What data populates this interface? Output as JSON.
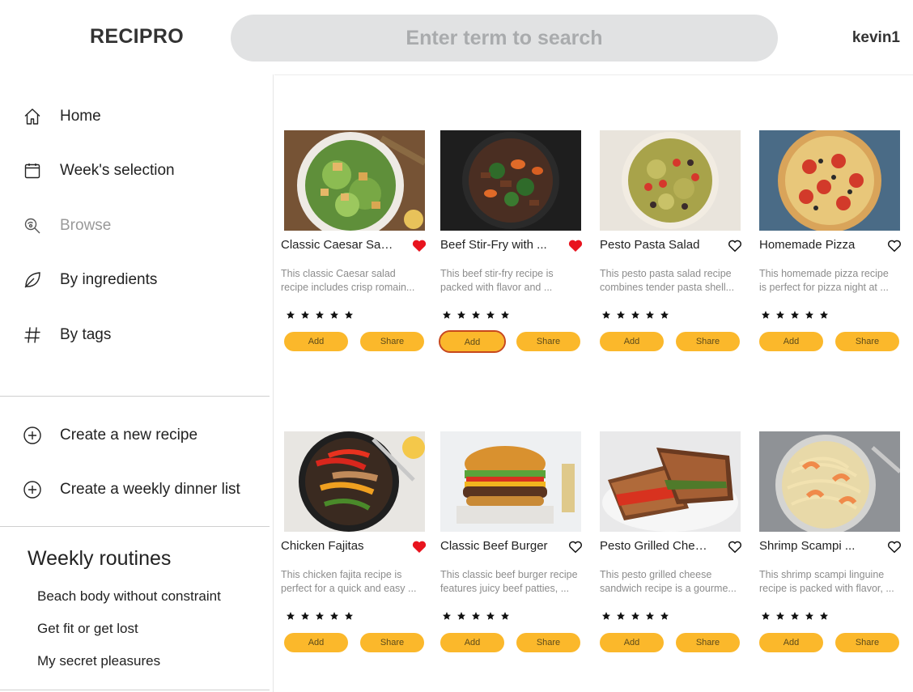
{
  "app": {
    "logo": "RECIPRO",
    "user": "kevin1"
  },
  "search": {
    "placeholder": "Enter term to search"
  },
  "nav": {
    "items": [
      {
        "label": "Home",
        "icon": "home-icon"
      },
      {
        "label": "Week's selection",
        "icon": "calendar-icon"
      },
      {
        "label": "Browse",
        "icon": "browse-icon"
      },
      {
        "label": "By ingredients",
        "icon": "leaf-icon"
      },
      {
        "label": "By tags",
        "icon": "hashtag-icon"
      }
    ],
    "actions": [
      {
        "label": "Create a new recipe",
        "icon": "plus-circle-icon"
      },
      {
        "label": "Create a weekly dinner list",
        "icon": "plus-circle-icon"
      }
    ]
  },
  "routines": {
    "title": "Weekly routines",
    "items": [
      "Beach body without constraint",
      "Get fit or get lost",
      "My secret pleasures"
    ]
  },
  "buttons": {
    "add": "Add",
    "share": "Share"
  },
  "colors": {
    "accent": "#fbb82b",
    "heart_active": "#e8141e",
    "focus_ring": "#c8481b"
  },
  "recipes": [
    {
      "title": "Classic Caesar Salad",
      "desc1": "This classic Caesar salad",
      "desc2": "recipe includes crisp romain...",
      "favorite": true,
      "rating": 5,
      "image": "caesar-salad-photo"
    },
    {
      "title": "Beef Stir-Fry with ...",
      "desc1": "This beef stir-fry recipe is",
      "desc2": "packed with flavor and ...",
      "favorite": true,
      "rating": 5,
      "image": "beef-stir-fry-photo"
    },
    {
      "title": "Pesto Pasta Salad",
      "desc1": "This pesto pasta salad recipe",
      "desc2": "combines tender pasta shell...",
      "favorite": false,
      "rating": 5,
      "image": "pesto-pasta-salad-photo"
    },
    {
      "title": "Homemade Pizza",
      "desc1": "This homemade pizza recipe",
      "desc2": "is perfect for pizza night at ...",
      "favorite": false,
      "rating": 5,
      "image": "homemade-pizza-photo"
    },
    {
      "title": "Chicken Fajitas",
      "desc1": "This chicken fajita recipe is",
      "desc2": "perfect for a quick and easy ...",
      "favorite": true,
      "rating": 5,
      "image": "chicken-fajitas-photo"
    },
    {
      "title": "Classic Beef Burger",
      "desc1": "This classic beef burger recipe",
      "desc2": "features juicy beef patties, ...",
      "favorite": false,
      "rating": 5,
      "image": "beef-burger-photo"
    },
    {
      "title": "Pesto Grilled Cheese",
      "desc1": "This pesto grilled cheese",
      "desc2": "sandwich recipe is a gourme...",
      "favorite": false,
      "rating": 5,
      "image": "grilled-cheese-photo"
    },
    {
      "title": "Shrimp Scampi ...",
      "desc1": "This shrimp scampi linguine",
      "desc2": "recipe is packed with flavor, ...",
      "favorite": false,
      "rating": 5,
      "image": "shrimp-scampi-photo"
    }
  ]
}
